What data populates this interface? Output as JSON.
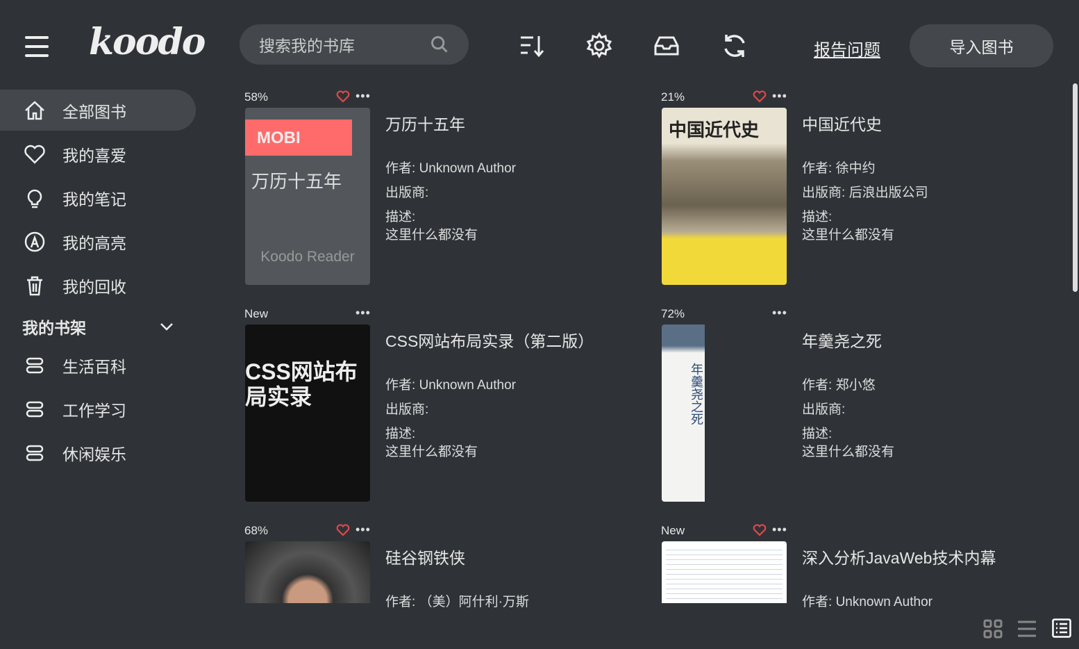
{
  "header": {
    "logo": "koodo",
    "search_placeholder": "搜索我的书库",
    "report": "报告问题",
    "import": "导入图书"
  },
  "sidebar": {
    "items": [
      {
        "label": "全部图书",
        "icon": "home-icon"
      },
      {
        "label": "我的喜爱",
        "icon": "heart-icon"
      },
      {
        "label": "我的笔记",
        "icon": "bulb-icon"
      },
      {
        "label": "我的高亮",
        "icon": "highlight-icon"
      },
      {
        "label": "我的回收",
        "icon": "trash-icon"
      }
    ],
    "shelf_title": "我的书架",
    "shelves": [
      "生活百科",
      "工作学习",
      "休闲娱乐"
    ]
  },
  "labels": {
    "author": "作者: ",
    "publisher": "出版商: ",
    "desc": "描述:",
    "empty": "这里什么都没有"
  },
  "books": [
    {
      "progress": "58%",
      "fav": true,
      "title": "万历十五年",
      "author": "Unknown Author",
      "publisher": "",
      "cover_format": "MOBI",
      "cover_title": "万历十五年",
      "cover_brand": "Koodo Reader"
    },
    {
      "progress": "21%",
      "fav": true,
      "title": "中国近代史",
      "author": "徐中约",
      "publisher": "后浪出版公司",
      "cover_title": "中国近代史"
    },
    {
      "progress": "New",
      "fav": false,
      "title": "CSS网站布局实录（第二版）",
      "author": "Unknown Author",
      "publisher": "",
      "cover_title": "CSS网站布局实录"
    },
    {
      "progress": "72%",
      "fav": false,
      "title": "年羹尧之死",
      "author": "郑小悠",
      "publisher": "",
      "cover_title": "年羹尧之死"
    },
    {
      "progress": "68%",
      "fav": true,
      "title": "硅谷钢铁侠",
      "author": "（美）阿什利·万斯",
      "publisher": ""
    },
    {
      "progress": "New",
      "fav": true,
      "title": "深入分析JavaWeb技术内幕",
      "author": "Unknown Author",
      "publisher": ""
    }
  ],
  "colors": {
    "bg": "#2f3337",
    "panel": "#44484c",
    "accent": "#ff6b6b",
    "heart": "#e04848"
  }
}
